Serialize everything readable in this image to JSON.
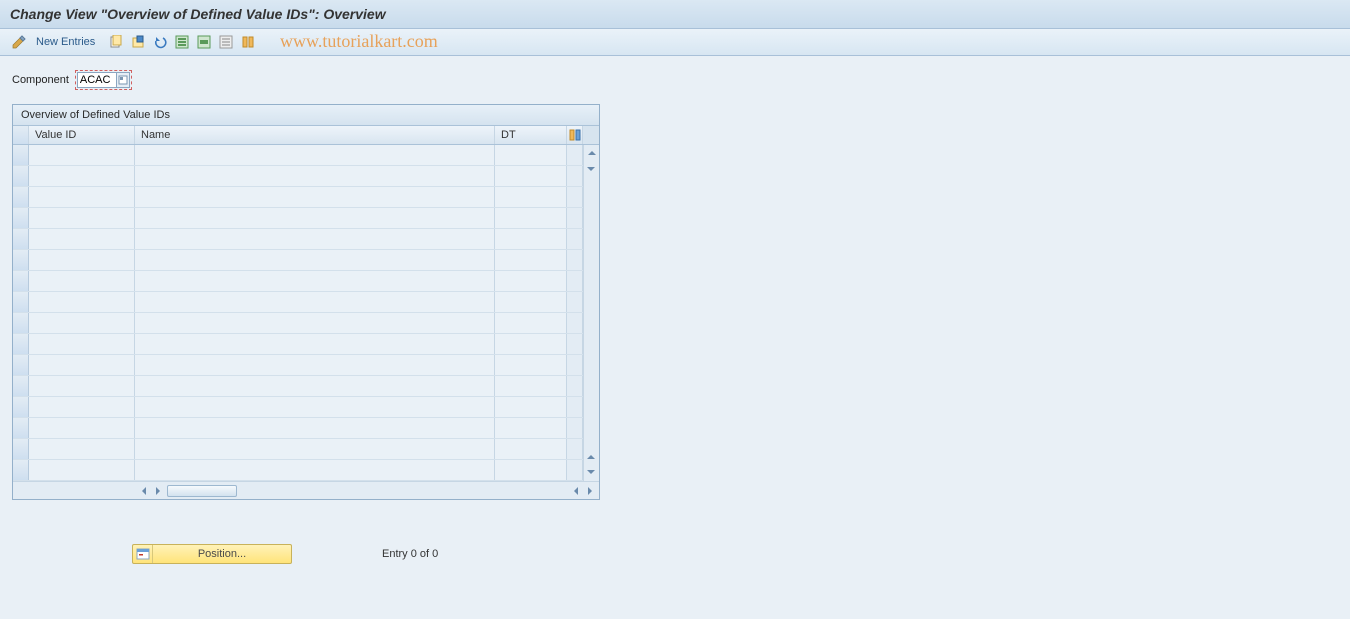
{
  "header": {
    "title": "Change View \"Overview of Defined Value IDs\": Overview"
  },
  "toolbar": {
    "new_entries_label": "New Entries"
  },
  "watermark": "www.tutorialkart.com",
  "component": {
    "label": "Component",
    "value": "ACAC"
  },
  "table": {
    "title": "Overview of Defined Value IDs",
    "columns": {
      "value_id": "Value ID",
      "name": "Name",
      "dt": "DT"
    },
    "rows": [
      {
        "value_id": "",
        "name": "",
        "dt": ""
      },
      {
        "value_id": "",
        "name": "",
        "dt": ""
      },
      {
        "value_id": "",
        "name": "",
        "dt": ""
      },
      {
        "value_id": "",
        "name": "",
        "dt": ""
      },
      {
        "value_id": "",
        "name": "",
        "dt": ""
      },
      {
        "value_id": "",
        "name": "",
        "dt": ""
      },
      {
        "value_id": "",
        "name": "",
        "dt": ""
      },
      {
        "value_id": "",
        "name": "",
        "dt": ""
      },
      {
        "value_id": "",
        "name": "",
        "dt": ""
      },
      {
        "value_id": "",
        "name": "",
        "dt": ""
      },
      {
        "value_id": "",
        "name": "",
        "dt": ""
      },
      {
        "value_id": "",
        "name": "",
        "dt": ""
      },
      {
        "value_id": "",
        "name": "",
        "dt": ""
      },
      {
        "value_id": "",
        "name": "",
        "dt": ""
      },
      {
        "value_id": "",
        "name": "",
        "dt": ""
      },
      {
        "value_id": "",
        "name": "",
        "dt": ""
      }
    ]
  },
  "footer": {
    "position_label": "Position...",
    "entry_status": "Entry 0 of 0"
  }
}
